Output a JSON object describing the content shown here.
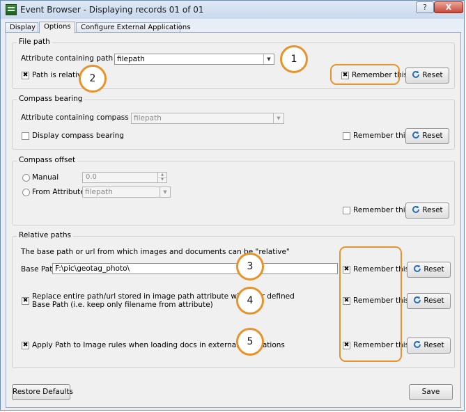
{
  "window": {
    "title": "Event Browser - Displaying records 01 of 01",
    "help": "?",
    "close": "X"
  },
  "tabs": [
    "Display",
    "Options",
    "Configure External Applications"
  ],
  "file_path": {
    "title": "File path",
    "attr_label": "Attribute containing path to file",
    "attr_value": "filepath",
    "relative_label": "Path is relative",
    "remember": "Remember this",
    "reset": "Reset"
  },
  "compass_bearing": {
    "title": "Compass bearing",
    "attr_label": "Attribute containing compass bearing",
    "attr_value": "filepath",
    "display_label": "Display compass bearing",
    "remember": "Remember this",
    "reset": "Reset"
  },
  "compass_offset": {
    "title": "Compass offset",
    "manual_label": "Manual",
    "manual_value": "0.0",
    "from_attr_label": "From Attribute",
    "from_attr_value": "filepath",
    "remember": "Remember this",
    "reset": "Reset"
  },
  "relative_paths": {
    "title": "Relative paths",
    "description": "The base path or url from which images and documents can be \"relative\"",
    "base_path_label": "Base Path",
    "base_path_value": "F:\\pic\\geotag_photo\\",
    "replace_label_1": "Replace entire path/url stored in image path attribute with user defined",
    "replace_label_2": "Base Path (i.e. keep only filename from attribute)",
    "apply_label": "Apply Path to Image rules when loading docs in external applications",
    "remember": "Remember this",
    "reset": "Reset"
  },
  "footer": {
    "restore": "Restore Defaults",
    "save": "Save"
  },
  "annotations": [
    "1",
    "2",
    "3",
    "4",
    "5"
  ],
  "checks": "✖",
  "colors": {
    "annotation": "#e8922a"
  }
}
